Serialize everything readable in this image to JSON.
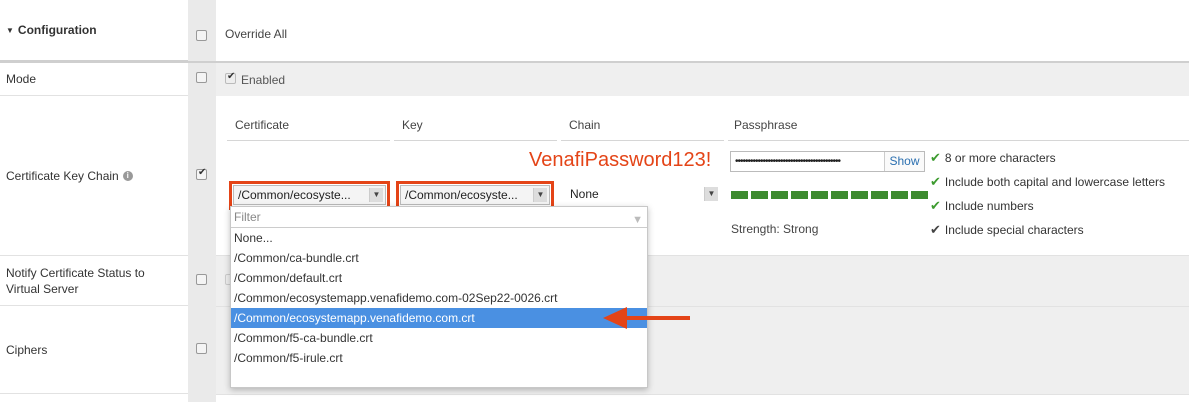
{
  "section_header": "Configuration",
  "override_all_label": "Override All",
  "rows": {
    "mode": {
      "label": "Mode",
      "value_label": "Enabled"
    },
    "cert_key_chain": {
      "label": "Certificate Key Chain"
    },
    "notify": {
      "label_line1": "Notify Certificate Status to",
      "label_line2": "Virtual Server"
    },
    "ciphers": {
      "label": "Ciphers"
    }
  },
  "columns": {
    "certificate": "Certificate",
    "key": "Key",
    "chain": "Chain",
    "passphrase": "Passphrase"
  },
  "selects": {
    "certificate_value": "/Common/ecosyste...",
    "key_value": "/Common/ecosyste...",
    "chain_value": "None"
  },
  "dropdown": {
    "filter_placeholder": "Filter",
    "options": [
      "None...",
      "/Common/ca-bundle.crt",
      "/Common/default.crt",
      "/Common/ecosystemapp.venafidemo.com-02Sep22-0026.crt",
      "/Common/ecosystemapp.venafidemo.com.crt",
      "/Common/f5-ca-bundle.crt",
      "/Common/f5-irule.crt"
    ],
    "selected_index": 4
  },
  "passphrase": {
    "masked_value": "••••••••••••••••••••••••••••••••••••••••••",
    "show_label": "Show",
    "strength_label": "Strength: Strong",
    "strength_segments": 10
  },
  "requirements": [
    {
      "text": "8 or more characters",
      "met": true
    },
    {
      "text": "Include both capital and lowercase letters",
      "met": true
    },
    {
      "text": "Include numbers",
      "met": true
    },
    {
      "text": "Include special characters",
      "met": true
    }
  ],
  "annotation_text": "VenafiPassword123!",
  "colors": {
    "annotation_red": "#e44417",
    "selected_blue": "#4a90e2",
    "strength_green": "#3d8b2f"
  }
}
